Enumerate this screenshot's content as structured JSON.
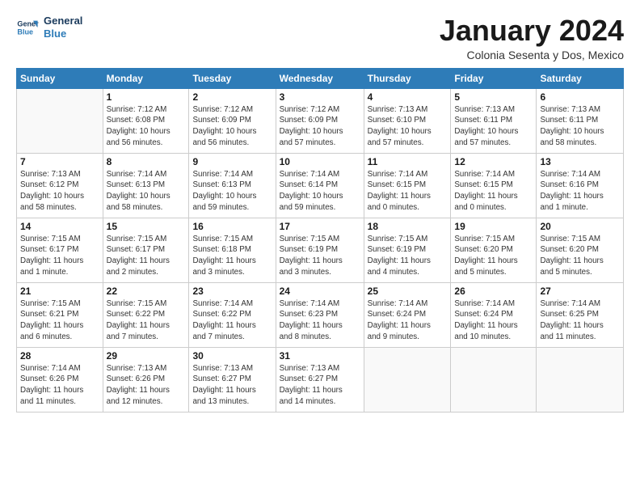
{
  "logo": {
    "line1": "General",
    "line2": "Blue"
  },
  "header": {
    "month": "January 2024",
    "location": "Colonia Sesenta y Dos, Mexico"
  },
  "columns": [
    "Sunday",
    "Monday",
    "Tuesday",
    "Wednesday",
    "Thursday",
    "Friday",
    "Saturday"
  ],
  "weeks": [
    [
      {
        "day": "",
        "info": ""
      },
      {
        "day": "1",
        "info": "Sunrise: 7:12 AM\nSunset: 6:08 PM\nDaylight: 10 hours\nand 56 minutes."
      },
      {
        "day": "2",
        "info": "Sunrise: 7:12 AM\nSunset: 6:09 PM\nDaylight: 10 hours\nand 56 minutes."
      },
      {
        "day": "3",
        "info": "Sunrise: 7:12 AM\nSunset: 6:09 PM\nDaylight: 10 hours\nand 57 minutes."
      },
      {
        "day": "4",
        "info": "Sunrise: 7:13 AM\nSunset: 6:10 PM\nDaylight: 10 hours\nand 57 minutes."
      },
      {
        "day": "5",
        "info": "Sunrise: 7:13 AM\nSunset: 6:11 PM\nDaylight: 10 hours\nand 57 minutes."
      },
      {
        "day": "6",
        "info": "Sunrise: 7:13 AM\nSunset: 6:11 PM\nDaylight: 10 hours\nand 58 minutes."
      }
    ],
    [
      {
        "day": "7",
        "info": "Sunrise: 7:13 AM\nSunset: 6:12 PM\nDaylight: 10 hours\nand 58 minutes."
      },
      {
        "day": "8",
        "info": "Sunrise: 7:14 AM\nSunset: 6:13 PM\nDaylight: 10 hours\nand 58 minutes."
      },
      {
        "day": "9",
        "info": "Sunrise: 7:14 AM\nSunset: 6:13 PM\nDaylight: 10 hours\nand 59 minutes."
      },
      {
        "day": "10",
        "info": "Sunrise: 7:14 AM\nSunset: 6:14 PM\nDaylight: 10 hours\nand 59 minutes."
      },
      {
        "day": "11",
        "info": "Sunrise: 7:14 AM\nSunset: 6:15 PM\nDaylight: 11 hours\nand 0 minutes."
      },
      {
        "day": "12",
        "info": "Sunrise: 7:14 AM\nSunset: 6:15 PM\nDaylight: 11 hours\nand 0 minutes."
      },
      {
        "day": "13",
        "info": "Sunrise: 7:14 AM\nSunset: 6:16 PM\nDaylight: 11 hours\nand 1 minute."
      }
    ],
    [
      {
        "day": "14",
        "info": "Sunrise: 7:15 AM\nSunset: 6:17 PM\nDaylight: 11 hours\nand 1 minute."
      },
      {
        "day": "15",
        "info": "Sunrise: 7:15 AM\nSunset: 6:17 PM\nDaylight: 11 hours\nand 2 minutes."
      },
      {
        "day": "16",
        "info": "Sunrise: 7:15 AM\nSunset: 6:18 PM\nDaylight: 11 hours\nand 3 minutes."
      },
      {
        "day": "17",
        "info": "Sunrise: 7:15 AM\nSunset: 6:19 PM\nDaylight: 11 hours\nand 3 minutes."
      },
      {
        "day": "18",
        "info": "Sunrise: 7:15 AM\nSunset: 6:19 PM\nDaylight: 11 hours\nand 4 minutes."
      },
      {
        "day": "19",
        "info": "Sunrise: 7:15 AM\nSunset: 6:20 PM\nDaylight: 11 hours\nand 5 minutes."
      },
      {
        "day": "20",
        "info": "Sunrise: 7:15 AM\nSunset: 6:20 PM\nDaylight: 11 hours\nand 5 minutes."
      }
    ],
    [
      {
        "day": "21",
        "info": "Sunrise: 7:15 AM\nSunset: 6:21 PM\nDaylight: 11 hours\nand 6 minutes."
      },
      {
        "day": "22",
        "info": "Sunrise: 7:15 AM\nSunset: 6:22 PM\nDaylight: 11 hours\nand 7 minutes."
      },
      {
        "day": "23",
        "info": "Sunrise: 7:14 AM\nSunset: 6:22 PM\nDaylight: 11 hours\nand 7 minutes."
      },
      {
        "day": "24",
        "info": "Sunrise: 7:14 AM\nSunset: 6:23 PM\nDaylight: 11 hours\nand 8 minutes."
      },
      {
        "day": "25",
        "info": "Sunrise: 7:14 AM\nSunset: 6:24 PM\nDaylight: 11 hours\nand 9 minutes."
      },
      {
        "day": "26",
        "info": "Sunrise: 7:14 AM\nSunset: 6:24 PM\nDaylight: 11 hours\nand 10 minutes."
      },
      {
        "day": "27",
        "info": "Sunrise: 7:14 AM\nSunset: 6:25 PM\nDaylight: 11 hours\nand 11 minutes."
      }
    ],
    [
      {
        "day": "28",
        "info": "Sunrise: 7:14 AM\nSunset: 6:26 PM\nDaylight: 11 hours\nand 11 minutes."
      },
      {
        "day": "29",
        "info": "Sunrise: 7:13 AM\nSunset: 6:26 PM\nDaylight: 11 hours\nand 12 minutes."
      },
      {
        "day": "30",
        "info": "Sunrise: 7:13 AM\nSunset: 6:27 PM\nDaylight: 11 hours\nand 13 minutes."
      },
      {
        "day": "31",
        "info": "Sunrise: 7:13 AM\nSunset: 6:27 PM\nDaylight: 11 hours\nand 14 minutes."
      },
      {
        "day": "",
        "info": ""
      },
      {
        "day": "",
        "info": ""
      },
      {
        "day": "",
        "info": ""
      }
    ]
  ]
}
